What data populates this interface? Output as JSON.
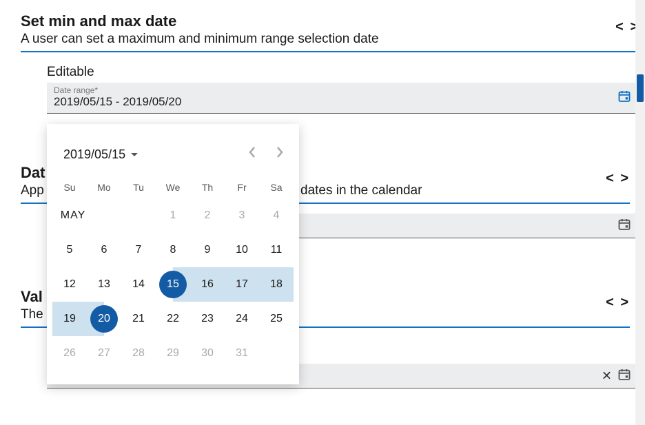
{
  "section1": {
    "title": "Set min and max date",
    "subtitle": "A user can set a maximum and minimum range selection date",
    "editable_label": "Editable",
    "field_label": "Date range*",
    "field_value": "2019/05/15 - 2019/05/20"
  },
  "section2": {
    "title_visible": "Dat",
    "subtitle_visible": "App",
    "subtitle_tail": "dates in the calendar"
  },
  "section3": {
    "title_visible": "Val",
    "subtitle_visible": "The"
  },
  "calendar": {
    "month_label": "2019/05/15",
    "dow": [
      "Su",
      "Mo",
      "Tu",
      "We",
      "Th",
      "Fr",
      "Sa"
    ],
    "month_text": "MAY",
    "weeks": [
      [
        null,
        null,
        null,
        {
          "d": 1,
          "dis": true
        },
        {
          "d": 2,
          "dis": true
        },
        {
          "d": 3,
          "dis": true
        },
        {
          "d": 4,
          "dis": true
        }
      ],
      [
        {
          "d": 5
        },
        {
          "d": 6
        },
        {
          "d": 7
        },
        {
          "d": 8
        },
        {
          "d": 9
        },
        {
          "d": 10
        },
        {
          "d": 11
        }
      ],
      [
        {
          "d": 12
        },
        {
          "d": 13
        },
        {
          "d": 14
        },
        {
          "d": 15,
          "sel": "start",
          "range": true
        },
        {
          "d": 16,
          "range": true
        },
        {
          "d": 17,
          "range": true
        },
        {
          "d": 18,
          "range": true
        }
      ],
      [
        {
          "d": 19,
          "range": true
        },
        {
          "d": 20,
          "sel": "end",
          "range": true
        },
        {
          "d": 21
        },
        {
          "d": 22
        },
        {
          "d": 23
        },
        {
          "d": 24
        },
        {
          "d": 25
        }
      ],
      [
        {
          "d": 26,
          "dis": true
        },
        {
          "d": 27,
          "dis": true
        },
        {
          "d": 28,
          "dis": true
        },
        {
          "d": 29,
          "dis": true
        },
        {
          "d": 30,
          "dis": true
        },
        {
          "d": 31,
          "dis": true
        },
        null
      ]
    ]
  },
  "icons": {
    "code_toggle": "< >"
  }
}
